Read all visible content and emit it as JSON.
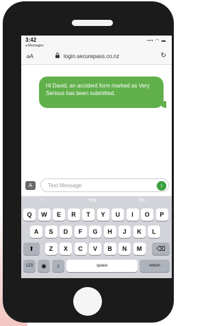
{
  "status_bar": {
    "time": "3:42",
    "back_label": "◂ Messages",
    "indicators": "▪▪▪ ◠ ▬"
  },
  "address_bar": {
    "text_size_label": "aA",
    "url": "login.securepass.co.nz",
    "lock_icon": "lock-icon",
    "reload_icon": "reload-icon"
  },
  "message": {
    "text": "Hi David, an accident form marked as Very Serious has been submitted.",
    "color": "#62b04c"
  },
  "compose": {
    "placeholder": "Text Message",
    "send_icon": "↑",
    "apps_icon": "A"
  },
  "keyboard": {
    "suggestions": [
      "I",
      "Yes",
      "It's"
    ],
    "row1": [
      "Q",
      "W",
      "E",
      "R",
      "T",
      "Y",
      "U",
      "I",
      "O",
      "P"
    ],
    "row2": [
      "A",
      "S",
      "D",
      "F",
      "G",
      "H",
      "J",
      "K",
      "L"
    ],
    "row3": [
      "Z",
      "X",
      "C",
      "V",
      "B",
      "N",
      "M"
    ],
    "shift": "⬆",
    "delete": "⌫",
    "numbers": "123",
    "globe": "◉",
    "mic": "♪",
    "space": "space",
    "return": "return"
  }
}
